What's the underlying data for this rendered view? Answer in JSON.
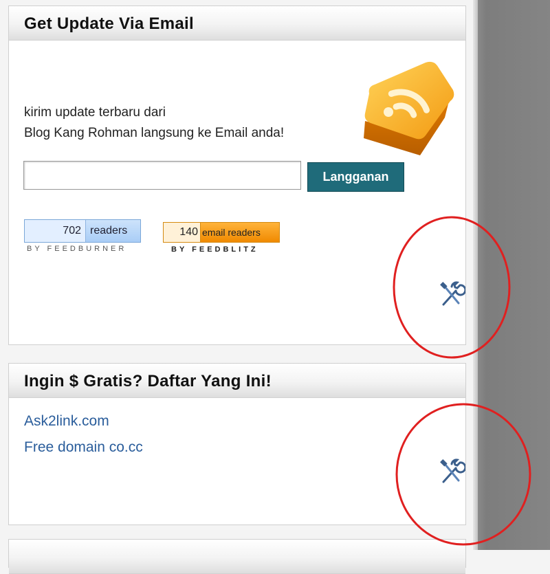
{
  "widgets": [
    {
      "title": "Get Update Via Email",
      "description_lines": [
        "kirim update terbaru dari",
        "Blog Kang Rohman langsung ke Email anda!"
      ],
      "email_input": {
        "value": "",
        "placeholder": ""
      },
      "subscribe_label": "Langganan",
      "feedburner": {
        "count": "702",
        "label": "readers",
        "byline": "BY FEEDBURNER"
      },
      "feedblitz": {
        "count": "140",
        "label": "email readers",
        "byline": "BY FEEDBLITZ"
      },
      "edit_icon": "wrench-screwdriver-icon"
    },
    {
      "title": "Ingin $ Gratis? Daftar Yang Ini!",
      "links": [
        "Ask2link.com",
        "Free domain co.cc"
      ],
      "edit_icon": "wrench-screwdriver-icon"
    }
  ],
  "colors": {
    "subscribe_button": "#1f6b7a",
    "link": "#2a5d9b",
    "annotation_circle": "#e02020",
    "rss_orange": "#f39a12"
  }
}
